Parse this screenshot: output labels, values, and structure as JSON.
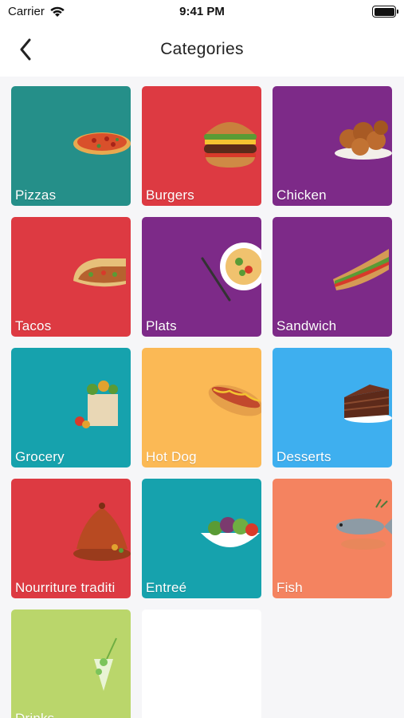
{
  "status_bar": {
    "carrier": "Carrier",
    "time": "9:41 PM"
  },
  "nav": {
    "title": "Categories",
    "back_icon": "chevron-left-icon"
  },
  "colors": {
    "teal": "#258f89",
    "red": "#dd3a42",
    "purple": "#7d2a88",
    "cyan": "#16a2ad",
    "amber": "#fbb955",
    "sky": "#3eafef",
    "coral": "#f48360",
    "lime": "#bad66b",
    "placeholder": "#ffffff"
  },
  "categories": [
    {
      "label": "Pizzas",
      "color": "#258f89",
      "icon": "pizza-icon"
    },
    {
      "label": "Burgers",
      "color": "#dd3a42",
      "icon": "burger-icon"
    },
    {
      "label": "Chicken",
      "color": "#7d2a88",
      "icon": "chicken-icon"
    },
    {
      "label": "Tacos",
      "color": "#dd3a42",
      "icon": "tacos-icon"
    },
    {
      "label": "Plats",
      "color": "#7d2a88",
      "icon": "plate-icon"
    },
    {
      "label": "Sandwich",
      "color": "#7d2a88",
      "icon": "sandwich-icon"
    },
    {
      "label": "Grocery",
      "color": "#16a2ad",
      "icon": "grocery-bag-icon"
    },
    {
      "label": "Hot Dog",
      "color": "#fbb955",
      "icon": "hotdog-icon"
    },
    {
      "label": "Desserts",
      "color": "#3eafef",
      "icon": "cake-icon"
    },
    {
      "label": "Nourriture traditi",
      "color": "#dd3a42",
      "icon": "tajine-icon"
    },
    {
      "label": "Entreé",
      "color": "#16a2ad",
      "icon": "salad-icon"
    },
    {
      "label": "Fish",
      "color": "#f48360",
      "icon": "fish-icon"
    },
    {
      "label": "Drinks",
      "color": "#bad66b",
      "icon": "drink-icon"
    }
  ]
}
